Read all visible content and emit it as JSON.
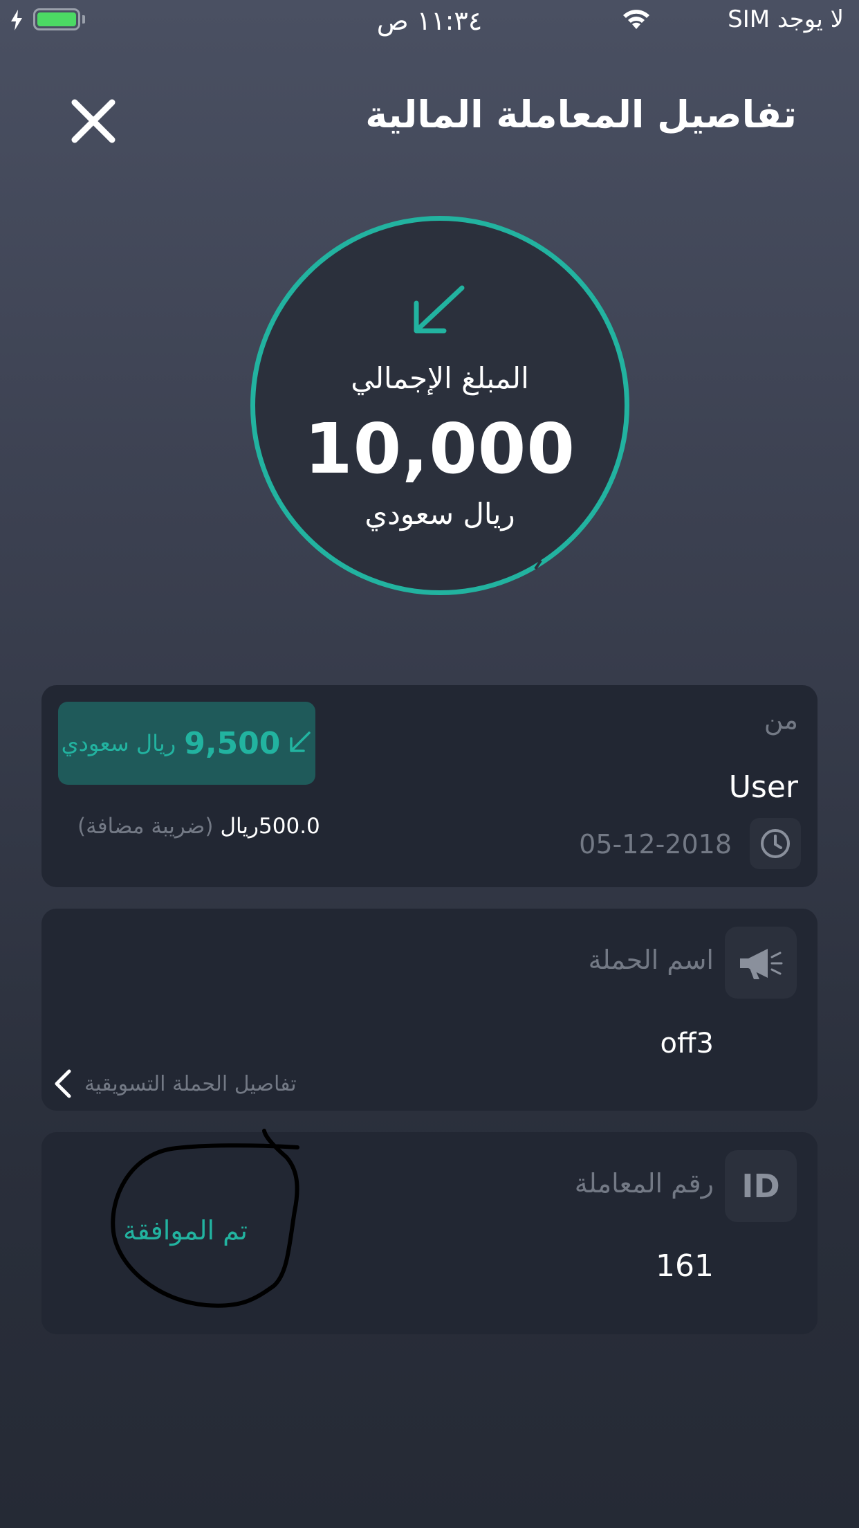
{
  "status_bar": {
    "carrier": "لا يوجد SIM",
    "time": "١١:٣٤ ص"
  },
  "header": {
    "title": "تفاصيل المعاملة المالية"
  },
  "total": {
    "label": "المبلغ الإجمالي",
    "amount": "10,000",
    "currency": "ريال سعودي"
  },
  "from_card": {
    "label": "من",
    "user": "User",
    "date": "05-12-2018",
    "badge_value": "9,500",
    "badge_currency": "ريال سعودي",
    "tax_value": "500.0ريال",
    "tax_label": "(ضريبة مضافة)"
  },
  "campaign_card": {
    "label": "اسم الحملة",
    "value": "off3",
    "link": "تفاصيل الحملة التسويقية"
  },
  "transaction_card": {
    "id_badge": "ID",
    "label": "رقم المعاملة",
    "value": "161",
    "status": "تم الموافقة"
  },
  "colors": {
    "accent": "#22b3a0",
    "card": "#222733",
    "muted_text": "#737985",
    "battery": "#4cd964"
  }
}
